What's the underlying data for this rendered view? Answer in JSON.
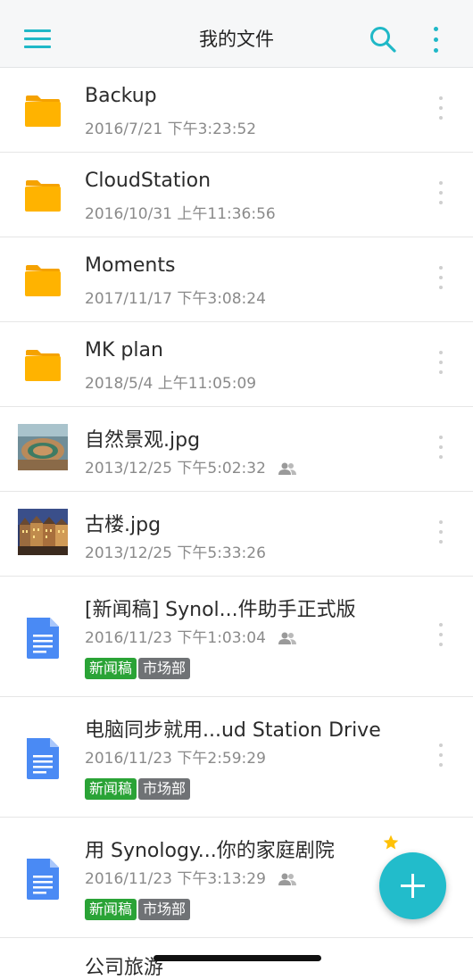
{
  "header": {
    "title": "我的文件"
  },
  "files": [
    {
      "name": "Backup",
      "date": "2016/7/21 下午3:23:52",
      "kind": "folder"
    },
    {
      "name": "CloudStation",
      "date": "2016/10/31 上午11:36:56",
      "kind": "folder"
    },
    {
      "name": "Moments",
      "date": "2017/11/17 下午3:08:24",
      "kind": "folder"
    },
    {
      "name": "MK plan",
      "date": "2018/5/4 上午11:05:09",
      "kind": "folder"
    },
    {
      "name": "自然景观.jpg",
      "date": "2013/12/25 下午5:02:32",
      "kind": "image-landscape",
      "shared": true
    },
    {
      "name": "古楼.jpg",
      "date": "2013/12/25 下午5:33:26",
      "kind": "image-buildings"
    },
    {
      "name": "[新闻稿] Synol...件助手正式版",
      "date": "2016/11/23 下午1:03:04",
      "kind": "doc",
      "shared": true,
      "tags": [
        "新闻稿",
        "市场部"
      ]
    },
    {
      "name": "电脑同步就用...ud Station Drive",
      "date": "2016/11/23 下午2:59:29",
      "kind": "doc",
      "tags": [
        "新闻稿",
        "市场部"
      ]
    },
    {
      "name": "用 Synology...你的家庭剧院",
      "date": "2016/11/23 下午3:13:29",
      "kind": "doc",
      "shared": true,
      "starred": true,
      "tags": [
        "新闻稿",
        "市场部"
      ]
    }
  ],
  "partial_item": {
    "name": "公司旅游"
  },
  "colors": {
    "accent": "#1fb8c7",
    "fab": "#22bccb",
    "folder": "#ffb300",
    "doc": "#4a8af4",
    "tag_green": "#2aa336",
    "tag_gray": "#6f7275",
    "star": "#ffc107"
  },
  "icons": {
    "menu": "hamburger-icon",
    "search": "search-icon",
    "more": "more-vertical-icon",
    "folder": "folder-icon",
    "doc": "document-icon",
    "shared": "shared-users-icon",
    "star": "star-icon",
    "add": "plus-icon"
  }
}
